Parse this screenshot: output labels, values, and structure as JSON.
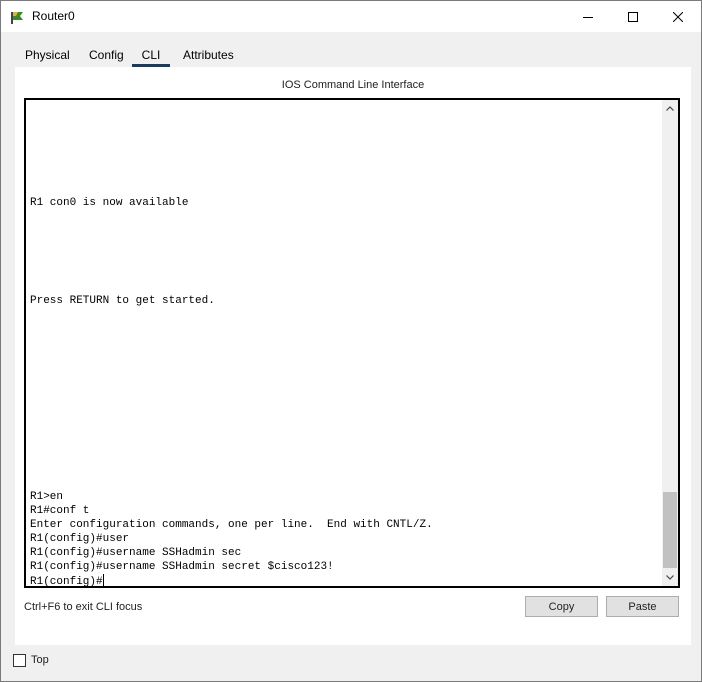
{
  "window": {
    "title": "Router0",
    "icon": "router-app-icon"
  },
  "tabs": [
    {
      "label": "Physical",
      "active": false
    },
    {
      "label": "Config",
      "active": false
    },
    {
      "label": "CLI",
      "active": true
    },
    {
      "label": "Attributes",
      "active": false
    }
  ],
  "panel": {
    "title": "IOS Command Line Interface"
  },
  "terminal": {
    "lines": [
      "R1 con0 is now available",
      "Press RETURN to get started.",
      "R1>en",
      "R1#conf t",
      "Enter configuration commands, one per line.  End with CNTL/Z.",
      "R1(config)#user",
      "R1(config)#username SSHadmin sec",
      "R1(config)#username SSHadmin secret $cisco123!",
      "R1(config)#"
    ]
  },
  "footer": {
    "hint": "Ctrl+F6 to exit CLI focus",
    "copy_label": "Copy",
    "paste_label": "Paste"
  },
  "options": {
    "top_label": "Top",
    "top_checked": false
  }
}
